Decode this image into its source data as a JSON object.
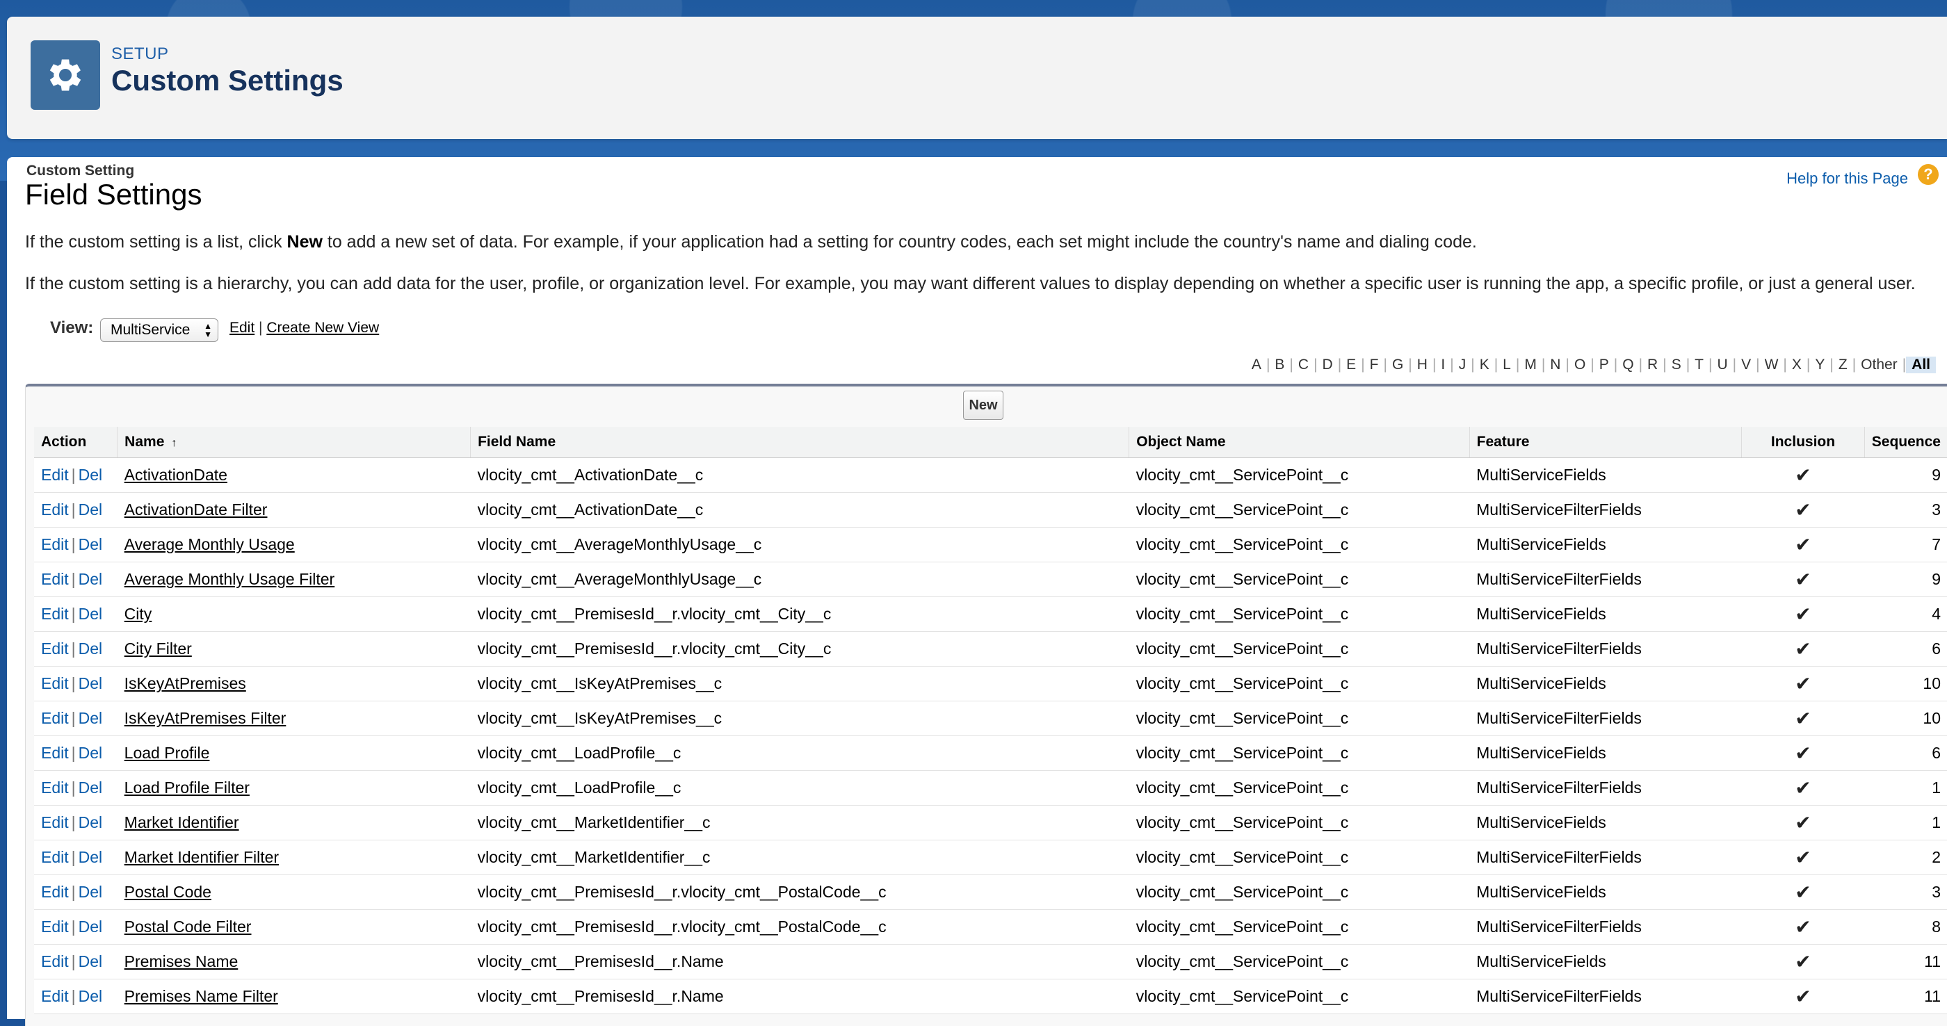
{
  "header": {
    "eyebrow": "SETUP",
    "title": "Custom Settings",
    "icon": "gear-icon"
  },
  "page": {
    "eyebrow": "Custom Setting",
    "title": "Field Settings",
    "help_link": "Help for this Page",
    "help_icon": "?",
    "para1_before": "If the custom setting is a list, click ",
    "para1_bold": "New",
    "para1_after": " to add a new set of data. For example, if your application had a setting for country codes, each set might include the country's name and dialing code.",
    "para2": "If the custom setting is a hierarchy, you can add data for the user, profile, or organization level. For example, you may want different values to display depending on whether a specific user is running the app, a specific profile, or just a general user."
  },
  "view": {
    "label": "View:",
    "selected": "MultiService",
    "edit_link": "Edit",
    "separator": "|",
    "create_link": "Create New View"
  },
  "alphabet": [
    "A",
    "B",
    "C",
    "D",
    "E",
    "F",
    "G",
    "H",
    "I",
    "J",
    "K",
    "L",
    "M",
    "N",
    "O",
    "P",
    "Q",
    "R",
    "S",
    "T",
    "U",
    "V",
    "W",
    "X",
    "Y",
    "Z",
    "Other",
    "All"
  ],
  "alphabet_active": "All",
  "toolbar": {
    "new_label": "New"
  },
  "table": {
    "columns": [
      "Action",
      "Name",
      "Field Name",
      "Object Name",
      "Feature",
      "Inclusion",
      "Sequence"
    ],
    "sort_indicator": "↑",
    "edit_label": "Edit",
    "del_label": "Del",
    "pipe": "|",
    "check": "✔",
    "rows": [
      {
        "name": "ActivationDate",
        "field": "vlocity_cmt__ActivationDate__c",
        "object": "vlocity_cmt__ServicePoint__c",
        "feature": "MultiServiceFields",
        "seq": "9"
      },
      {
        "name": "ActivationDate Filter",
        "field": "vlocity_cmt__ActivationDate__c",
        "object": "vlocity_cmt__ServicePoint__c",
        "feature": "MultiServiceFilterFields",
        "seq": "3"
      },
      {
        "name": "Average Monthly Usage",
        "field": "vlocity_cmt__AverageMonthlyUsage__c",
        "object": "vlocity_cmt__ServicePoint__c",
        "feature": "MultiServiceFields",
        "seq": "7"
      },
      {
        "name": "Average Monthly Usage Filter",
        "field": "vlocity_cmt__AverageMonthlyUsage__c",
        "object": "vlocity_cmt__ServicePoint__c",
        "feature": "MultiServiceFilterFields",
        "seq": "9"
      },
      {
        "name": "City",
        "field": "vlocity_cmt__PremisesId__r.vlocity_cmt__City__c",
        "object": "vlocity_cmt__ServicePoint__c",
        "feature": "MultiServiceFields",
        "seq": "4"
      },
      {
        "name": "City Filter",
        "field": "vlocity_cmt__PremisesId__r.vlocity_cmt__City__c",
        "object": "vlocity_cmt__ServicePoint__c",
        "feature": "MultiServiceFilterFields",
        "seq": "6"
      },
      {
        "name": "IsKeyAtPremises",
        "field": "vlocity_cmt__IsKeyAtPremises__c",
        "object": "vlocity_cmt__ServicePoint__c",
        "feature": "MultiServiceFields",
        "seq": "10"
      },
      {
        "name": "IsKeyAtPremises Filter",
        "field": "vlocity_cmt__IsKeyAtPremises__c",
        "object": "vlocity_cmt__ServicePoint__c",
        "feature": "MultiServiceFilterFields",
        "seq": "10"
      },
      {
        "name": "Load Profile",
        "field": "vlocity_cmt__LoadProfile__c",
        "object": "vlocity_cmt__ServicePoint__c",
        "feature": "MultiServiceFields",
        "seq": "6"
      },
      {
        "name": "Load Profile Filter",
        "field": "vlocity_cmt__LoadProfile__c",
        "object": "vlocity_cmt__ServicePoint__c",
        "feature": "MultiServiceFilterFields",
        "seq": "1"
      },
      {
        "name": "Market Identifier",
        "field": "vlocity_cmt__MarketIdentifier__c",
        "object": "vlocity_cmt__ServicePoint__c",
        "feature": "MultiServiceFields",
        "seq": "1"
      },
      {
        "name": "Market Identifier Filter",
        "field": "vlocity_cmt__MarketIdentifier__c",
        "object": "vlocity_cmt__ServicePoint__c",
        "feature": "MultiServiceFilterFields",
        "seq": "2"
      },
      {
        "name": "Postal Code",
        "field": "vlocity_cmt__PremisesId__r.vlocity_cmt__PostalCode__c",
        "object": "vlocity_cmt__ServicePoint__c",
        "feature": "MultiServiceFields",
        "seq": "3"
      },
      {
        "name": "Postal Code Filter",
        "field": "vlocity_cmt__PremisesId__r.vlocity_cmt__PostalCode__c",
        "object": "vlocity_cmt__ServicePoint__c",
        "feature": "MultiServiceFilterFields",
        "seq": "8"
      },
      {
        "name": "Premises Name",
        "field": "vlocity_cmt__PremisesId__r.Name",
        "object": "vlocity_cmt__ServicePoint__c",
        "feature": "MultiServiceFields",
        "seq": "11"
      },
      {
        "name": "Premises Name Filter",
        "field": "vlocity_cmt__PremisesId__r.Name",
        "object": "vlocity_cmt__ServicePoint__c",
        "feature": "MultiServiceFilterFields",
        "seq": "11"
      }
    ]
  }
}
